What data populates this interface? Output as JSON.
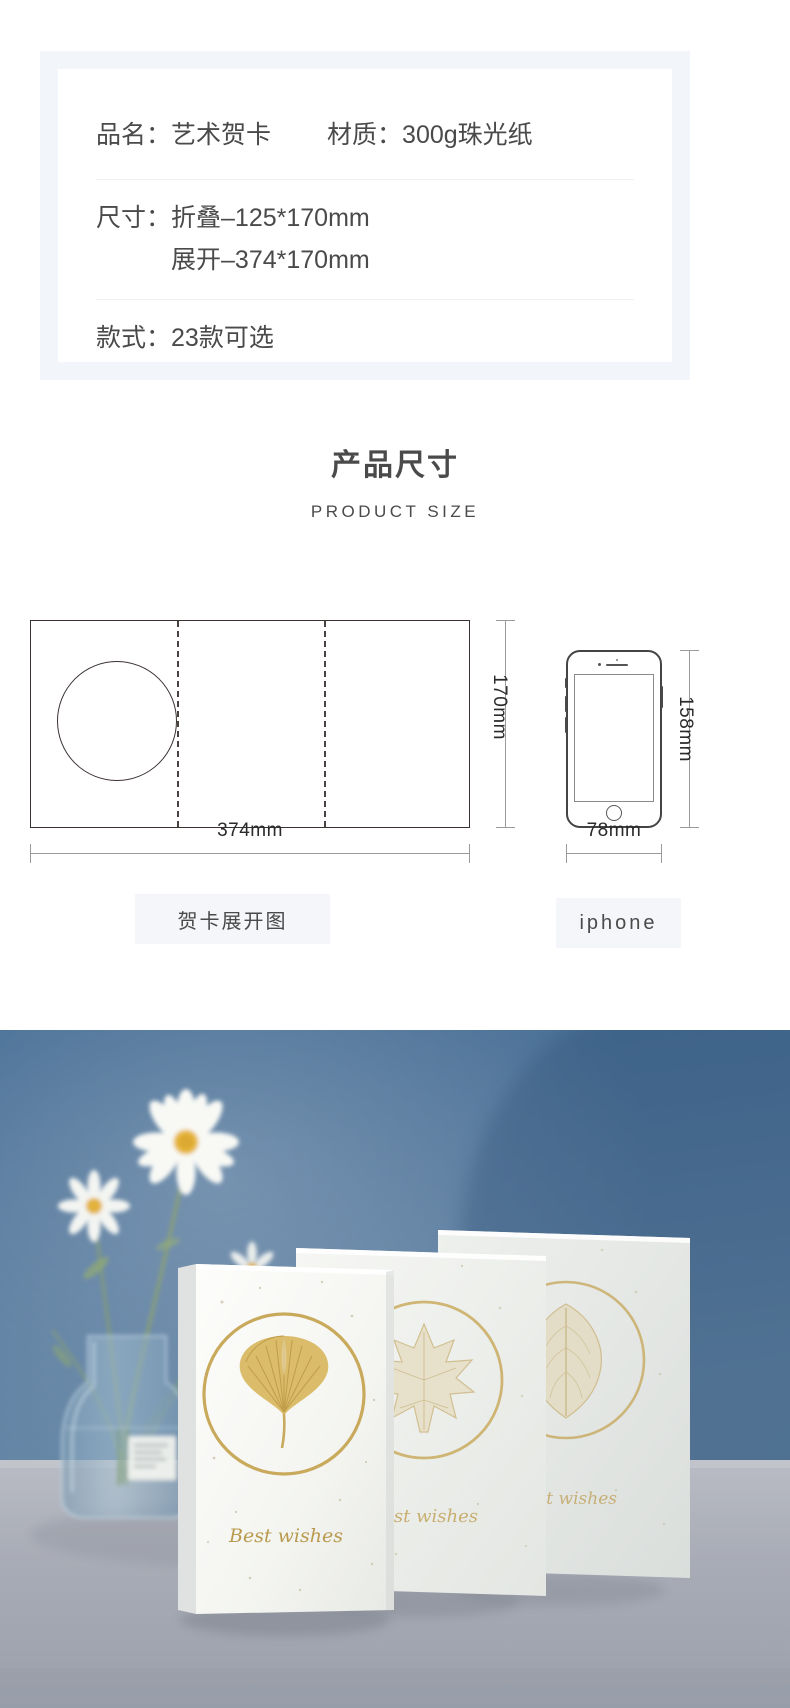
{
  "spec": {
    "rows": [
      {
        "pairs": [
          {
            "label": "品名：",
            "value": "艺术贺卡"
          },
          {
            "label": "材质：",
            "value": "300g珠光纸"
          }
        ]
      },
      {
        "label": "尺寸：",
        "values": [
          "折叠–125*170mm",
          "展开–374*170mm"
        ]
      },
      {
        "label": "款式：",
        "value": "23款可选"
      }
    ]
  },
  "section": {
    "title_cn": "产品尺寸",
    "title_en": "PRODUCT SIZE"
  },
  "diagram": {
    "card": {
      "width_label": "374mm",
      "height_label": "170mm",
      "caption": "贺卡展开图"
    },
    "phone": {
      "width_label": "78mm",
      "height_label": "158mm",
      "caption": "iphone"
    }
  },
  "photo": {
    "card_front_text": "Best wishes",
    "card_mid_text": "Best wishes",
    "card_back_text": "Best wishes"
  },
  "colors": {
    "frame_bg": "#f2f5f9",
    "panel_bg": "#ffffff",
    "text_dark": "#4a4a4a",
    "divider": "#eceff3",
    "dim_line": "#9a9a9a",
    "outline": "#3a3230",
    "caption_bg": "#f4f6f9",
    "photo_blue": "#4a6f92",
    "gold": "#c9ab63"
  }
}
